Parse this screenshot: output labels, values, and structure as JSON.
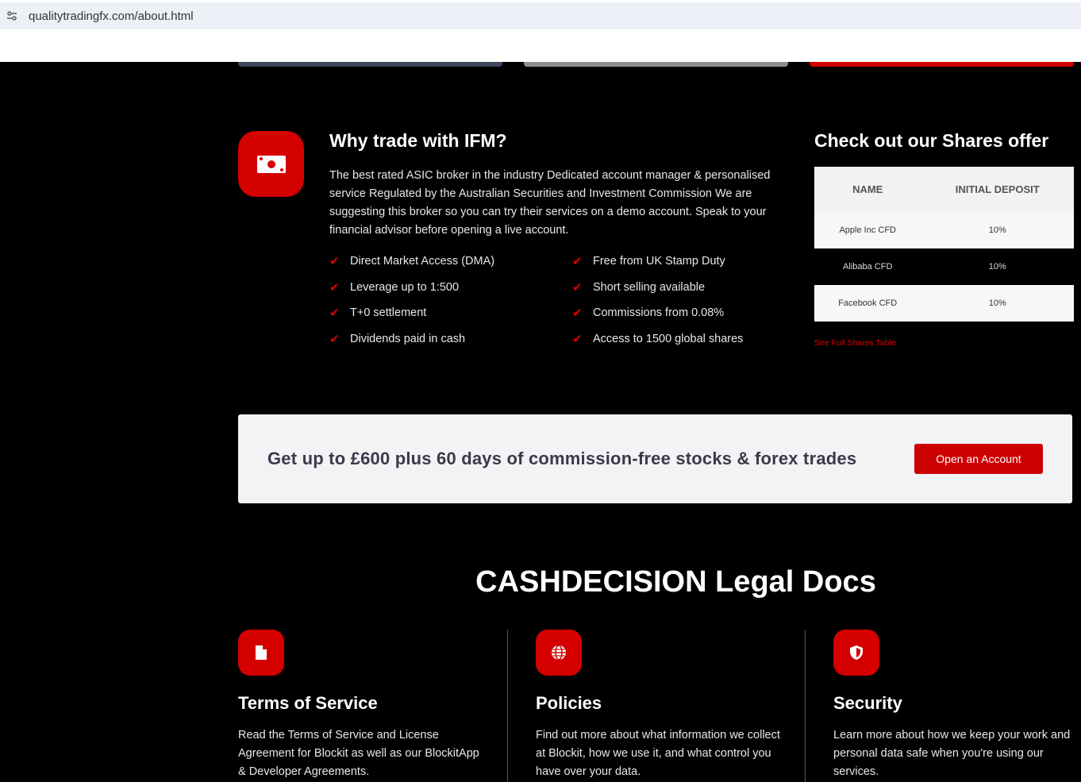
{
  "browser": {
    "url": "qualitytradingfx.com/about.html"
  },
  "top_bars": [
    {
      "color": "#3c4a5c"
    },
    {
      "color": "#8a9090"
    },
    {
      "color": "#d40000"
    }
  ],
  "why": {
    "icon": "money-icon",
    "title": "Why trade with IFM?",
    "description": "The best rated ASIC broker in the industry Dedicated account manager & personalised service Regulated by the Australian Securities and Investment Commission We are suggesting this broker so you can try their services on a demo account. Speak to your financial advisor before opening a live account.",
    "features": [
      "Direct Market Access (DMA)",
      "Free from UK Stamp Duty",
      "Leverage up to 1:500",
      "Short selling available",
      "T+0 settlement",
      "Commissions from 0.08%",
      "Dividends paid in cash",
      "Access to 1500 global shares"
    ]
  },
  "shares": {
    "title": "Check out our Shares offer",
    "columns": [
      "NAME",
      "INITIAL DEPOSIT"
    ],
    "rows": [
      {
        "name": "Apple Inc CFD",
        "deposit": "10%"
      },
      {
        "name": "Alibaba CFD",
        "deposit": "10%"
      },
      {
        "name": "Facebook CFD",
        "deposit": "10%"
      }
    ],
    "link": "See Full Shares Table"
  },
  "promo": {
    "text": "Get up to £600 plus 60 days of commission-free stocks & forex trades",
    "button": "Open an Account"
  },
  "legal": {
    "title": "CASHDECISION Legal Docs",
    "docs": [
      {
        "icon": "document-icon",
        "title": "Terms of Service",
        "text": "Read the Terms of Service and License Agreement for Blockit as well as our BlockitApp & Developer Agreements."
      },
      {
        "icon": "globe-icon",
        "title": "Policies",
        "text": "Find out more about what information we collect at Blockit, how we use it, and what control you have over your data."
      },
      {
        "icon": "shield-icon",
        "title": "Security",
        "text": "Learn more about how we keep your work and personal data safe when you're using our services."
      }
    ]
  },
  "colors": {
    "accent": "#d40000",
    "background": "#000000",
    "promo_bg": "#f2f3f5"
  }
}
